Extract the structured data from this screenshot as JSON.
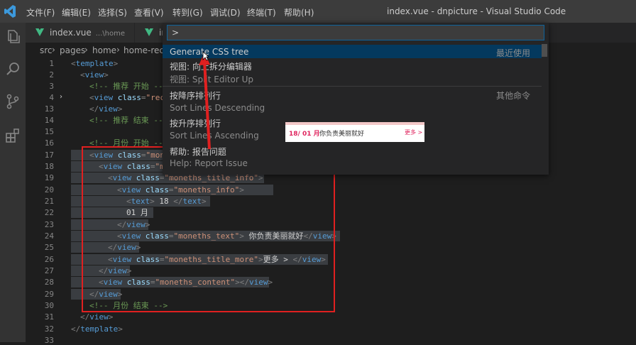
{
  "menubar": {
    "items": [
      "文件(F)",
      "编辑(E)",
      "选择(S)",
      "查看(V)",
      "转到(G)",
      "调试(D)",
      "终端(T)",
      "帮助(H)"
    ],
    "window_title": "index.vue - dnpicture - Visual Studio Code"
  },
  "tabs": [
    {
      "label": "index.vue",
      "description": "...\\home"
    },
    {
      "label": "in",
      "description": ""
    }
  ],
  "breadcrumb": [
    "src",
    "pages",
    "home",
    "home-reco"
  ],
  "palette": {
    "input_value": ">",
    "items": [
      {
        "label": "Generate CSS tree",
        "desc": "",
        "group": "最近使用",
        "selected": true
      },
      {
        "label": "视图: 向上拆分编辑器",
        "desc": "视图: Split Editor Up",
        "group": ""
      },
      {
        "label": "按降序排列行",
        "desc": "Sort Lines Descending",
        "group": "其他命令"
      },
      {
        "label": "按升序排列行",
        "desc": "Sort Lines Ascending",
        "group": ""
      },
      {
        "label": "帮助: 报告问题",
        "desc": "Help: Report Issue",
        "group": ""
      }
    ]
  },
  "preview": {
    "date": "18/ 01 月",
    "text": "你负责美丽就好",
    "more": "更多 >"
  },
  "code": {
    "line_numbers": [
      "1",
      "2",
      "3",
      "4",
      "13",
      "14",
      "15",
      "16",
      "17",
      "18",
      "19",
      "20",
      "21",
      "22",
      "23",
      "24",
      "25",
      "26",
      "27",
      "28",
      "29",
      "30",
      "31",
      "32",
      "33"
    ],
    "lines": {
      "l1_tag": "template",
      "l2_tag": "view",
      "l3_comment": "<!-- 推荐 开始 -->",
      "l4_tag": "view",
      "l4_attr": "class",
      "l4_val": "\"rec",
      "l13_tag": "view",
      "l14_comment": "<!-- 推荐 结束 -->",
      "l16_comment": "<!-- 月份 开始 -->",
      "l17_tag": "view",
      "l17_attr": "class",
      "l17_val": "\"mon",
      "l18_tag": "view",
      "l18_attr": "class",
      "l18_val": "\"m",
      "l19_tag": "view",
      "l19_attr": "class",
      "l19_val": "\"moneths_title_info\"",
      "l20_tag": "view",
      "l20_attr": "class",
      "l20_val": "\"moneths_info\"",
      "l21_tag": "text",
      "l21_text": " 18 ",
      "l21_close": "text",
      "l22_text": "01 月",
      "l23_tag": "view",
      "l24_tag": "view",
      "l24_attr": "class",
      "l24_val": "\"moneths_text\"",
      "l24_text": " 你负责美丽就好",
      "l24_close": "view",
      "l25_tag": "view",
      "l26_tag": "view",
      "l26_attr": "class",
      "l26_val": "\"moneths_title_more\"",
      "l26_text": "更多 > ",
      "l26_close": "view",
      "l27_tag": "view",
      "l28_tag": "view",
      "l28_attr": "class",
      "l28_val": "\"moneths_content\"",
      "l28_close": "view",
      "l29_tag": "view",
      "l30_comment": "<!-- 月份 结束 -->",
      "l31_tag": "view",
      "l32_tag": "template"
    }
  },
  "colors": {
    "accent": "#0e639c",
    "annotation": "#e02020",
    "vue_green": "#41b883"
  }
}
